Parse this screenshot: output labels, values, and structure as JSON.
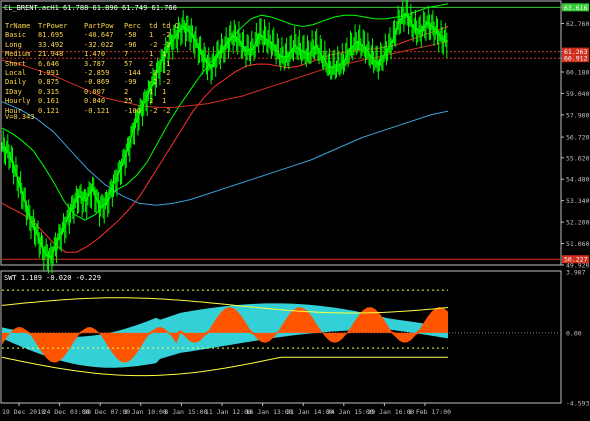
{
  "window": {
    "symbol": "CL_BRENT.acH1",
    "ohlc": "61.788 61.890 61.749 61.760",
    "subwindow_title": "SWT 1.189 -0.020 -0.229"
  },
  "info_table": {
    "headers": [
      "TrName",
      "TrPower",
      "PartPow",
      "Perc",
      "td",
      "td_O"
    ],
    "rows": [
      [
        "Basic",
        "81.695",
        "-40.647",
        "-50",
        "1",
        "-2"
      ],
      [
        "Long",
        "33.492",
        "-32.022",
        "-96",
        "-2",
        "-2"
      ],
      [
        "Medium",
        "21.948",
        "1.470",
        "7",
        "1",
        "1"
      ],
      [
        "Short",
        "6.646",
        "3.787",
        "57",
        "2",
        "-1"
      ],
      [
        "Local",
        "1.991",
        "-2.859",
        "-144",
        "-2",
        "-2"
      ],
      [
        "Daily",
        "0.875",
        "-0.869",
        "-99",
        "-2",
        "-2"
      ],
      [
        "IDay",
        "0.315",
        "0.007",
        "2",
        "1",
        "1"
      ],
      [
        "Hourly",
        "0.161",
        "0.040",
        "25",
        "2",
        "1"
      ],
      [
        "Hour",
        "0.121",
        "-0.121",
        "-100",
        "-2",
        "-2"
      ]
    ],
    "v_line": "V=0.343"
  },
  "colors": {
    "background": "#000000",
    "candles": "#00ff00",
    "axis": "#c0c0c0",
    "table_text": "#ffd84a",
    "upper_band": "#00ff00",
    "lower_band": "#ff3030",
    "slow_ma": "#3aa0d8",
    "level_line": "#d03020",
    "area_cyan": "#33d0d8",
    "area_orange": "#ff5500"
  },
  "chart_data": [
    {
      "type": "line",
      "title": "CL_BRENT.acH1 61.788 61.890 61.749 61.760",
      "y_ticks": [
        "63.616",
        "62.760",
        "61.263",
        "60.912",
        "60.180",
        "59.040",
        "57.900",
        "56.720",
        "55.620",
        "54.480",
        "53.340",
        "52.200",
        "51.060",
        "49.920"
      ],
      "price_labels": [
        {
          "value": "63.616",
          "color": "#33cc33"
        },
        {
          "value": "61.263",
          "color": "#d03020"
        },
        {
          "value": "60.912",
          "color": "#d03020"
        },
        {
          "value": "50.227",
          "color": "#d03020"
        }
      ],
      "x_ticks": [
        "19 Dec 2018",
        "24 Dec 03:00",
        "28 Dec 07:00",
        "3 Jan 10:00",
        "8 Jan 15:00",
        "11 Jan 12:00",
        "16 Jan 13:00",
        "21 Jan 14:00",
        "24 Jan 15:00",
        "29 Jan 16:00",
        "1 Feb 17:00"
      ],
      "ylim": [
        49.92,
        63.9
      ],
      "series": [
        {
          "values": [
            56.2,
            55.9,
            54.8,
            53.6,
            52.4,
            51.6,
            50.6,
            50.3,
            51.2,
            52.0,
            52.9,
            53.6,
            53.3,
            54.0,
            53.0,
            53.2,
            54.2,
            55.0,
            56.0,
            57.3,
            58.2,
            59.0,
            59.9,
            60.8,
            61.6,
            62.1,
            62.6,
            62.3,
            61.6,
            60.9,
            60.4,
            61.1,
            61.5,
            62.1,
            61.9,
            61.3,
            61.4,
            62.2,
            61.9,
            61.6,
            61.0,
            61.0,
            61.6,
            61.3,
            61.1,
            61.6,
            61.0,
            60.4,
            60.5,
            60.7,
            61.4,
            61.8,
            61.5,
            61.0,
            60.6,
            61.2,
            61.8,
            62.9,
            63.3,
            62.6,
            62.3,
            62.8,
            62.5,
            62.0,
            61.8
          ]
        },
        {
          "values": [
            57.2,
            56.9,
            56.5,
            56.0,
            55.2,
            54.3,
            53.3,
            52.6,
            52.3,
            52.6,
            53.2,
            53.9,
            54.2,
            54.7,
            55.4,
            56.4,
            57.4,
            58.3,
            59.1,
            59.9,
            60.6,
            61.3,
            61.9,
            62.5,
            63.0,
            63.2,
            63.1,
            62.9,
            62.7,
            62.6,
            62.7,
            62.9,
            63.1,
            63.2,
            63.2,
            63.1,
            63.0,
            63.0,
            63.1,
            63.2,
            63.4,
            63.6,
            63.7,
            63.8
          ]
        },
        {
          "values": [
            53.2,
            52.9,
            52.6,
            52.2,
            51.6,
            51.0,
            50.6,
            50.6,
            50.9,
            51.3,
            51.8,
            52.3,
            52.9,
            53.6,
            54.5,
            55.4,
            56.3,
            57.2,
            58.1,
            58.8,
            59.4,
            59.8,
            60.2,
            60.5,
            60.6,
            60.6,
            60.5,
            60.4,
            60.5,
            60.7,
            60.9,
            61.1,
            61.2,
            61.3,
            61.4,
            61.4,
            61.5,
            61.6,
            61.8,
            62.0,
            62.2,
            62.4,
            62.6
          ]
        },
        {
          "values": [
            58.6,
            58.2,
            57.7,
            57.0,
            56.0,
            55.0,
            54.2,
            53.6,
            53.2,
            53.1,
            53.2,
            53.4,
            53.7,
            54.0,
            54.3,
            54.6,
            54.9,
            55.2,
            55.5,
            55.9,
            56.3,
            56.7,
            57.0,
            57.3,
            57.6,
            57.9,
            58.1
          ]
        },
        {
          "values": [
            60.8,
            60.6,
            60.3,
            60.0,
            59.6,
            59.2,
            58.8,
            58.6,
            58.4,
            58.3,
            58.3,
            58.4,
            58.5,
            58.7,
            58.9,
            59.2,
            59.5,
            59.8,
            60.1,
            60.4,
            60.6,
            60.8,
            61.0,
            61.2,
            61.4,
            61.6,
            61.8
          ]
        }
      ]
    },
    {
      "type": "area",
      "title": "SWT 1.189 -0.020 -0.229",
      "y_ticks": [
        "3.987",
        "0.00",
        "-4.593"
      ],
      "ylim": [
        -4.593,
        3.987
      ]
    }
  ]
}
